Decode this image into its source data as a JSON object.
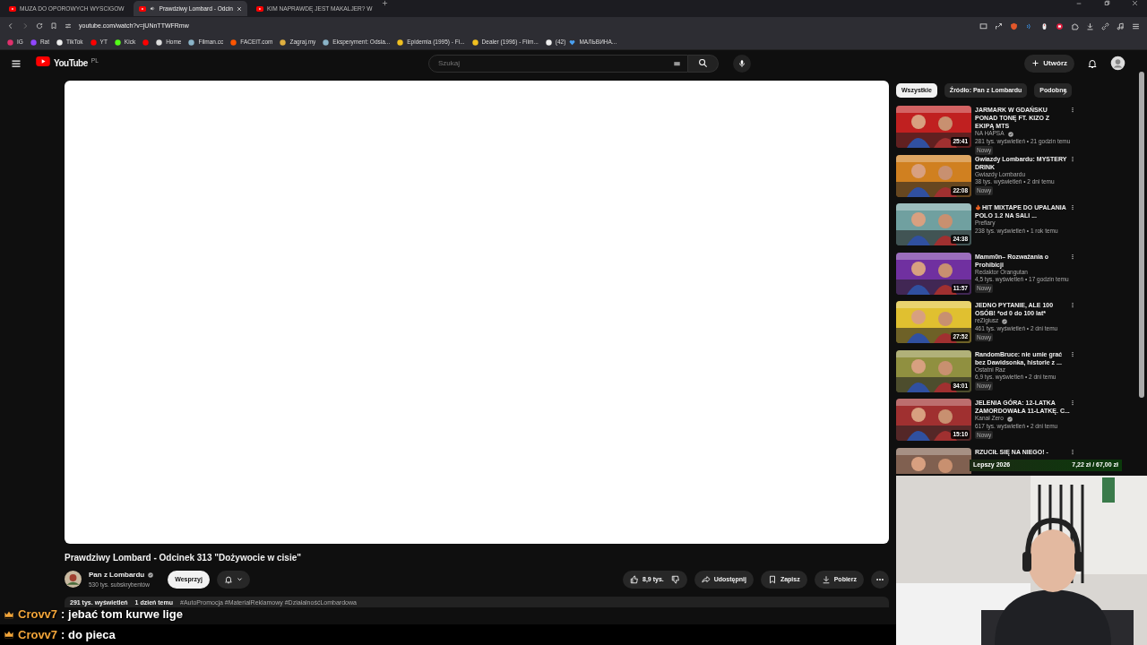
{
  "browser": {
    "tabs": [
      {
        "title": "MUZA DO OPOROWYCH WYSCIGOW",
        "selected": false,
        "audio": false
      },
      {
        "title": "Prawdziwy Lombard - Odcin",
        "selected": true,
        "audio": true
      },
      {
        "title": "KIM NAPRAWDĘ JEST MAKALJER? W",
        "selected": false,
        "audio": false
      }
    ],
    "url": "youtube.com/watch?v=jUNnTTWFRmw",
    "bookmarks": [
      {
        "label": "IG",
        "color": "#e1306c"
      },
      {
        "label": "Rat",
        "color": "#9146ff"
      },
      {
        "label": "TikTok",
        "color": "#eeeeee"
      },
      {
        "label": "YT",
        "color": "#ff0000"
      },
      {
        "label": "Kick",
        "color": "#53fc18"
      },
      {
        "color": "#ff0000"
      },
      {
        "label": "Home",
        "color": "#dddddd"
      },
      {
        "label": "Filman.cc",
        "color": "#8ab4c8"
      },
      {
        "label": "FACEIT.com",
        "color": "#ff5500"
      },
      {
        "label": "Zagraj.my",
        "color": "#e0b040"
      },
      {
        "label": "Eksperyment: Odsia...",
        "color": "#8ab4c8"
      },
      {
        "label": "Epidemia (1995) - Fi...",
        "color": "#f0c020"
      },
      {
        "label": "Dealer (1996) - Film...",
        "color": "#f0c020"
      },
      {
        "label": "(42)",
        "heart": true,
        "label_after": "МАЛЬВИНА...",
        "color": "#eeeeee"
      }
    ]
  },
  "youtube": {
    "logo": "YouTube",
    "country": "PL",
    "search": {
      "placeholder": "Szukaj"
    },
    "create": "Utwórz",
    "chips": [
      {
        "label": "Wszystkie",
        "selected": true
      },
      {
        "label": "Źródło: Pan z Lombardu",
        "selected": false
      },
      {
        "label": "Podobne",
        "selected": false
      }
    ],
    "video": {
      "title": "Prawdziwy Lombard - Odcinek 313 \"Dożywocie w cisie\"",
      "channel": "Pan z Lombardu",
      "verified": true,
      "subscribers": "530 tys. subskrybentów",
      "support": "Wesprzyj",
      "likes": "8,9 tys.",
      "share": "Udostępnij",
      "save": "Zapisz",
      "download": "Pobierz",
      "description": {
        "views": "291 tys. wyświetleń",
        "date": "1 dzień temu",
        "hashtags": "#AutoPromocja #MaterialReklamowy #DziałalnośćLombardowa"
      }
    },
    "recommendations": [
      {
        "title": "JARMARK W GDAŃSKU PONAD TONĘ FT. KIZO Z EKIPĄ MTS",
        "channel": "NA HAPSA",
        "verified": true,
        "meta": "281 tys. wyświetleń • 21 godzin temu",
        "badge": "Nowy",
        "duration": "25:41"
      },
      {
        "title": "Gwiazdy Lombardu: MYSTERY DRINK",
        "channel": "Gwiazdy Lombardu",
        "verified": false,
        "meta": "38 tys. wyświetleń • 2 dni temu",
        "badge": "Nowy",
        "duration": "22:08"
      },
      {
        "title": "HIT MIXTAPE DO UPALANIA POLO 1.2 NA SALI ...",
        "fire": true,
        "channel": "Prefiary",
        "verified": false,
        "meta": "238 tys. wyświetleń • 1 rok temu",
        "duration": "24:38"
      },
      {
        "title": "Mamm0n– Rozważania o Prohibicji",
        "channel": "Redaktor Orangutan",
        "verified": false,
        "meta": "4,5 tys. wyświetleń • 17 godzin temu",
        "badge": "Nowy",
        "duration": "11:57"
      },
      {
        "title": "JEDNO PYTANIE, ALE 100 OSÓB! *od 0 do 100 lat*",
        "channel": "reZigiusz",
        "verified": true,
        "meta": "461 tys. wyświetleń • 2 dni temu",
        "badge": "Nowy",
        "duration": "27:52"
      },
      {
        "title": "RandomBruce: nie umie grać bez Dawidsonka, historie z ...",
        "channel": "Ostatni Raz",
        "verified": false,
        "meta": "6,9 tys. wyświetleń • 2 dni temu",
        "badge": "Nowy",
        "duration": "34:01"
      },
      {
        "title": "JELENIA GÓRA: 12-LATKA ZAMORDOWAŁA 11-LATKĘ. C...",
        "channel": "Kanał Zero",
        "verified": true,
        "meta": "617 tys. wyświetleń • 2 dni temu",
        "badge": "Nowy",
        "duration": "15:10"
      },
      {
        "title": "RZUCIŁ SIĘ NA NIEGO! -"
      }
    ]
  },
  "overlay": {
    "goal": {
      "label": "Lepszy 2026",
      "amount": "7,22 zł / 67,00 zł"
    },
    "chat": [
      {
        "user": "Crovv7",
        "text": ": jebać tom kurwe lige",
        "boxed": false
      },
      {
        "user": "Crovv7",
        "text": ": do pieca",
        "boxed": true
      }
    ]
  }
}
